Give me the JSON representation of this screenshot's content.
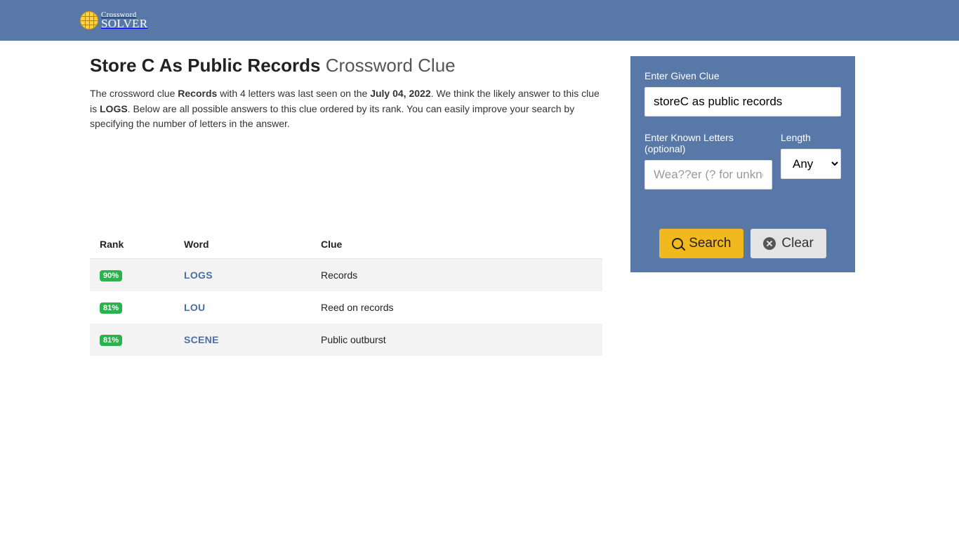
{
  "brand": {
    "top": "Crossword",
    "bottom": "SOLVER"
  },
  "page": {
    "title_main": "Store C As Public Records",
    "title_suffix": "Crossword Clue",
    "intro_prefix": "The crossword clue ",
    "intro_clue_bold": "Records",
    "intro_mid1": " with 4 letters was last seen on the ",
    "intro_date_bold": "July 04, 2022",
    "intro_mid2": ". We think the likely answer to this clue is ",
    "intro_answer_bold": "LOGS",
    "intro_tail": ". Below are all possible answers to this clue ordered by its rank. You can easily improve your search by specifying the number of letters in the answer."
  },
  "table": {
    "headers": {
      "rank": "Rank",
      "word": "Word",
      "clue": "Clue"
    },
    "rows": [
      {
        "rank": "90%",
        "word": "LOGS",
        "clue": "Records"
      },
      {
        "rank": "81%",
        "word": "LOU",
        "clue": "Reed on records"
      },
      {
        "rank": "81%",
        "word": "SCENE",
        "clue": "Public outburst"
      }
    ]
  },
  "sidebar": {
    "clue_label": "Enter Given Clue",
    "clue_value": "storeC as public records",
    "letters_label": "Enter Known Letters (optional)",
    "letters_placeholder": "Wea??er (? for unknown)",
    "length_label": "Length",
    "length_value": "Any",
    "search_label": "Search",
    "clear_label": "Clear"
  }
}
